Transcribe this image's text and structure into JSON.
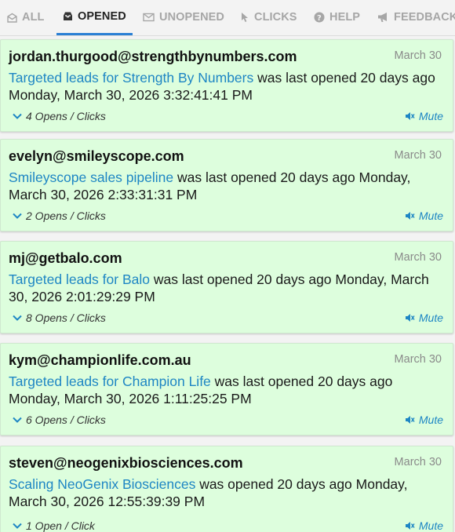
{
  "tabs": [
    {
      "label": "ALL",
      "icon": "envelope-open-icon"
    },
    {
      "label": "OPENED",
      "icon": "inbox-icon"
    },
    {
      "label": "UNOPENED",
      "icon": "envelope-icon"
    },
    {
      "label": "CLICKS",
      "icon": "cursor-icon"
    },
    {
      "label": "HELP",
      "icon": "question-icon"
    },
    {
      "label": "FEEDBACK",
      "icon": "megaphone-icon"
    }
  ],
  "active_tab": "OPENED",
  "colors": {
    "accent": "#2a7fd4",
    "link": "#1e86c4",
    "card_bg": "#ddfedd"
  },
  "mute_label": "Mute",
  "items": [
    {
      "email": "jordan.thurgood@strengthbynumbers.com",
      "date": "March 30",
      "subject": "Targeted leads for Strength By Numbers",
      "detail": " was last opened 20 days ago Monday, March 30, 2026 3:32:41:41 PM",
      "opens": "4 Opens / Clicks"
    },
    {
      "email": "evelyn@smileyscope.com",
      "date": "March 30",
      "subject": "Smileyscope sales pipeline",
      "detail": " was last opened 20 days ago Monday, March 30, 2026 2:33:31:31 PM",
      "opens": "2 Opens / Clicks"
    },
    {
      "email": "mj@getbalo.com",
      "date": "March 30",
      "subject": "Targeted leads for Balo",
      "detail": " was last opened 20 days ago Monday, March 30, 2026 2:01:29:29 PM",
      "opens": "8 Opens / Clicks"
    },
    {
      "email": "kym@championlife.com.au",
      "date": "March 30",
      "subject": "Targeted leads for Champion Life",
      "detail": " was last opened 20 days ago Monday, March 30, 2026 1:11:25:25 PM",
      "opens": "6 Opens / Clicks"
    },
    {
      "email": "steven@neogenixbiosciences.com",
      "date": "March 30",
      "subject": "Scaling NeoGenix Biosciences",
      "detail": " was opened 20 days ago Monday, March 30, 2026 12:55:39:39 PM",
      "opens": "1 Open / Click"
    }
  ]
}
